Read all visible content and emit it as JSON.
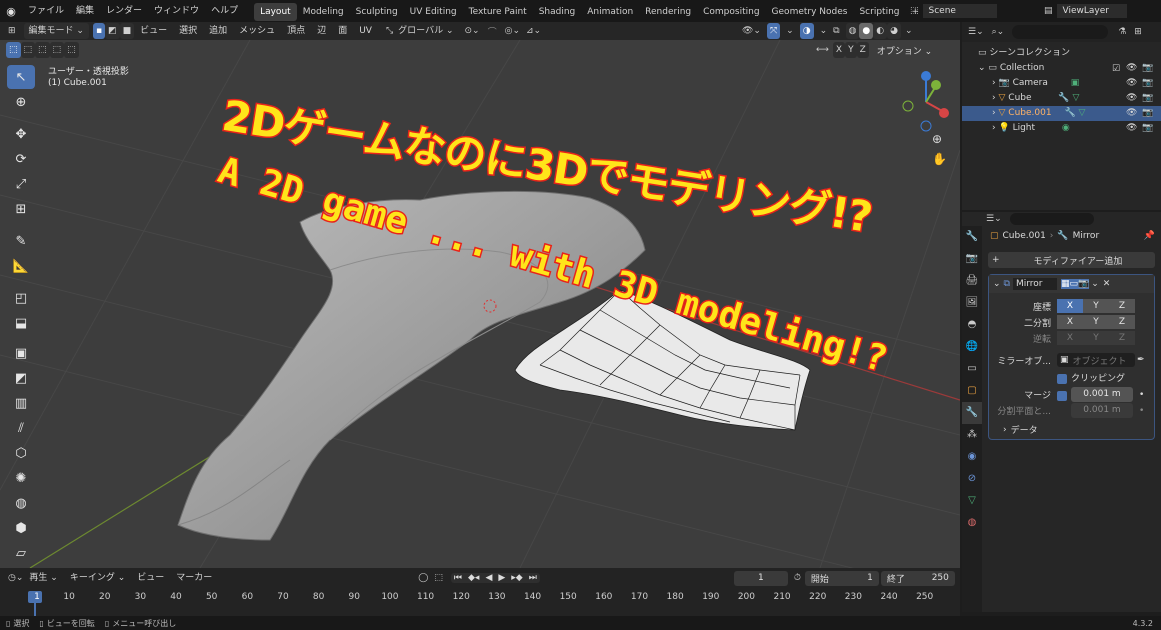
{
  "topbar": {
    "menus": [
      "ファイル",
      "編集",
      "レンダー",
      "ウィンドウ",
      "ヘルプ"
    ],
    "workspaces": [
      "Layout",
      "Modeling",
      "Sculpting",
      "UV Editing",
      "Texture Paint",
      "Shading",
      "Animation",
      "Rendering",
      "Compositing",
      "Geometry Nodes",
      "Scripting"
    ],
    "active_workspace": "Layout",
    "add_tab": "+",
    "scene": "Scene",
    "view_layer": "ViewLayer"
  },
  "viewport_header": {
    "mode": "編集モード",
    "menus": [
      "ビュー",
      "選択",
      "追加",
      "メッシュ",
      "頂点",
      "辺",
      "面",
      "UV"
    ],
    "transform": "グローバル",
    "axes": [
      "X",
      "Y",
      "Z"
    ],
    "options": "オプション"
  },
  "viewport": {
    "view_name": "ユーザー・透視投影",
    "object_name": "(1) Cube.001"
  },
  "overlay": {
    "title_jp": "2Dゲームなのに3Dでモデリング!?",
    "title_en": "A 2D game ... with 3D modeling!?"
  },
  "outliner": {
    "root": "シーンコレクション",
    "collection": "Collection",
    "items": [
      {
        "name": "Camera"
      },
      {
        "name": "Cube"
      },
      {
        "name": "Cube.001"
      },
      {
        "name": "Light"
      }
    ]
  },
  "properties": {
    "object": "Cube.001",
    "modifier_tab": "Mirror",
    "add_modifier": "モディファイアー追加",
    "modifier_name": "Mirror",
    "rows": {
      "axis_label": "座標",
      "bisect_label": "二分割",
      "flip_label": "逆転",
      "mirror_object_label": "ミラーオブ...",
      "mirror_object_placeholder": "オブジェクト",
      "clipping": "クリッピング",
      "merge_label": "マージ",
      "merge_value": "0.001 m",
      "bisect_dist_label": "分割平面と...",
      "bisect_dist_value": "0.001 m",
      "data": "データ"
    }
  },
  "timeline": {
    "menus": [
      "再生",
      "キーイング",
      "ビュー",
      "マーカー"
    ],
    "current_frame": "1",
    "start_label": "開始",
    "start": "1",
    "end_label": "終了",
    "end": "250",
    "ticks": [
      "1",
      "10",
      "20",
      "30",
      "40",
      "50",
      "60",
      "70",
      "80",
      "90",
      "100",
      "110",
      "120",
      "130",
      "140",
      "150",
      "160",
      "170",
      "180",
      "190",
      "200",
      "210",
      "220",
      "230",
      "240",
      "250"
    ]
  },
  "statusbar": {
    "select": "選択",
    "rotate": "ビューを回転",
    "menu": "メニュー呼び出し",
    "version": "4.3.2"
  },
  "colors": {
    "accent": "#4a72b0",
    "overlay_fill": "#ffe51a",
    "overlay_stroke": "#e8231a"
  }
}
